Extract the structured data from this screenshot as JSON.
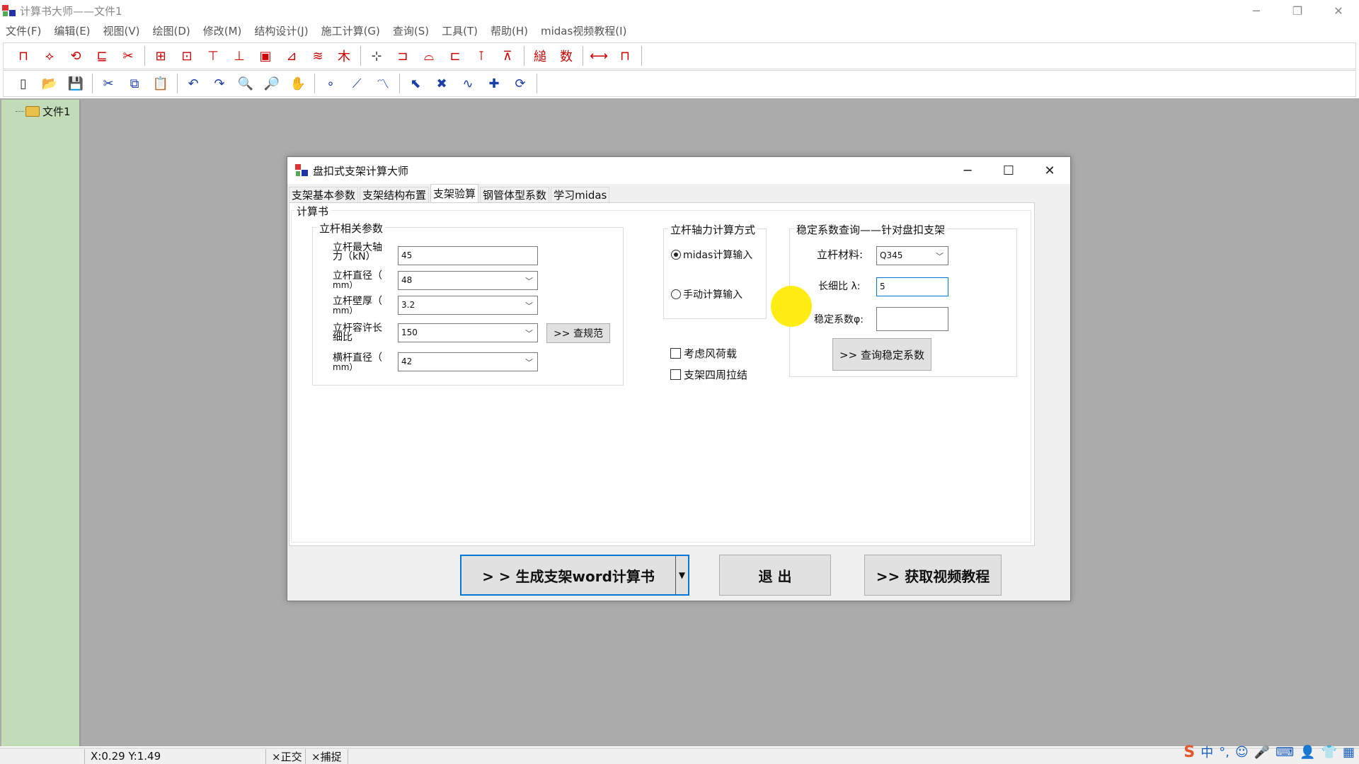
{
  "app": {
    "title": "计算书大师——文件1",
    "menu": [
      "文件(F)",
      "编辑(E)",
      "视图(V)",
      "绘图(D)",
      "修改(M)",
      "结构设计(J)",
      "施工计算(G)",
      "查询(S)",
      "工具(T)",
      "帮助(H)",
      "midas视频教程(I)"
    ],
    "window_controls": [
      "─",
      "❐",
      "✕"
    ]
  },
  "toolbar1": {
    "icons": [
      "beam-icon",
      "truss-icon",
      "rotate-icon",
      "column-icon",
      "cut-icon",
      "formwork-icon",
      "box-icon",
      "bracket-icon",
      "scaffold-icon",
      "frame-icon",
      "tower-icon",
      "stack-icon",
      "timber-icon",
      "axis-icon",
      "pier-icon",
      "arch-icon",
      "rebar-icon",
      "pile-icon",
      "load-icon",
      "calc-icon",
      "number-icon",
      "pipe-icon",
      "bridge-icon"
    ],
    "glyphs": [
      "⊓",
      "⟡",
      "⟲",
      "⊑",
      "✂",
      "⊞",
      "⊡",
      "⊤",
      "⊥",
      "▣",
      "⊿",
      "≋",
      "木",
      "⊹",
      "⊐",
      "⌓",
      "⊏",
      "⊺",
      "⊼",
      "縋",
      "数",
      "⟷",
      "⊓"
    ]
  },
  "toolbar2": {
    "icons": [
      "new-file-icon",
      "open-folder-icon",
      "save-icon",
      "cut-icon",
      "copy-icon",
      "paste-icon",
      "undo-icon",
      "redo-icon",
      "zoom-out-icon",
      "zoom-in-icon",
      "pan-hand-icon",
      "point-icon",
      "line-icon",
      "polyline-icon",
      "select-arrow-icon",
      "delete-x-icon",
      "link-icon",
      "move-icon",
      "refresh-icon"
    ],
    "glyphs": [
      "▯",
      "📂",
      "💾",
      "✂",
      "⧉",
      "📋",
      "↶",
      "↷",
      "🔍",
      "🔎",
      "✋",
      "∘",
      "⟋",
      "〽",
      "⬉",
      "✖",
      "∿",
      "✚",
      "⟳"
    ]
  },
  "tree": {
    "items": [
      "文件1"
    ]
  },
  "status": {
    "coords": "X:0.29  Y:1.49",
    "ortho": "×正交",
    "snap": "×捕捉"
  },
  "tray": {
    "icons": [
      "sogou-icon",
      "zh-icon",
      "punct-icon",
      "emoji-icon",
      "mic-icon",
      "keyboard-icon",
      "user-icon",
      "shirt-icon",
      "grid-icon"
    ],
    "glyphs": [
      "S",
      "中",
      "°,",
      "☺",
      "🎤",
      "⌨",
      "👤",
      "👕",
      "▦"
    ]
  },
  "dialog": {
    "title": "盘扣式支架计算大师",
    "controls": [
      "─",
      "☐",
      "✕"
    ],
    "tabs": [
      "支架基本参数",
      "支架结构布置",
      "支架验算",
      "钢管体型系数",
      "学习midas"
    ],
    "active_tab": 2,
    "section_title": "计算书",
    "pole_group": {
      "title": "立杆相关参数",
      "fields": [
        {
          "label1": "立杆最大轴",
          "label2": "力（kN）",
          "value": "45",
          "type": "text"
        },
        {
          "label1": "立杆直径（",
          "label2": "mm）",
          "value": "48",
          "type": "combo"
        },
        {
          "label1": "立杆壁厚（",
          "label2": "mm）",
          "value": "3.2",
          "type": "combo"
        },
        {
          "label1": "立杆容许长",
          "label2": "细比",
          "value": "150",
          "type": "combo"
        },
        {
          "label1": "横杆直径（",
          "label2": "mm）",
          "value": "42",
          "type": "combo"
        }
      ],
      "spec_button": ">> 查规范"
    },
    "axial_group": {
      "title": "立杆轴力计算方式",
      "options": [
        "midas计算输入",
        "手动计算输入"
      ],
      "selected": 0
    },
    "checks": [
      "考虑风荷载",
      "支架四周拉结"
    ],
    "stability_group": {
      "title": "稳定系数查询——针对盘扣支架",
      "material_label": "立杆材料:",
      "material_value": "Q345",
      "slenderness_label": "长细比 λ:",
      "slenderness_value": "5",
      "coef_label": "稳定系数φ:",
      "coef_value": "",
      "query_button": ">> 查询稳定系数"
    },
    "buttons": {
      "generate": "> > 生成支架word计算书",
      "exit": "退  出",
      "video": ">> 获取视频教程"
    }
  }
}
